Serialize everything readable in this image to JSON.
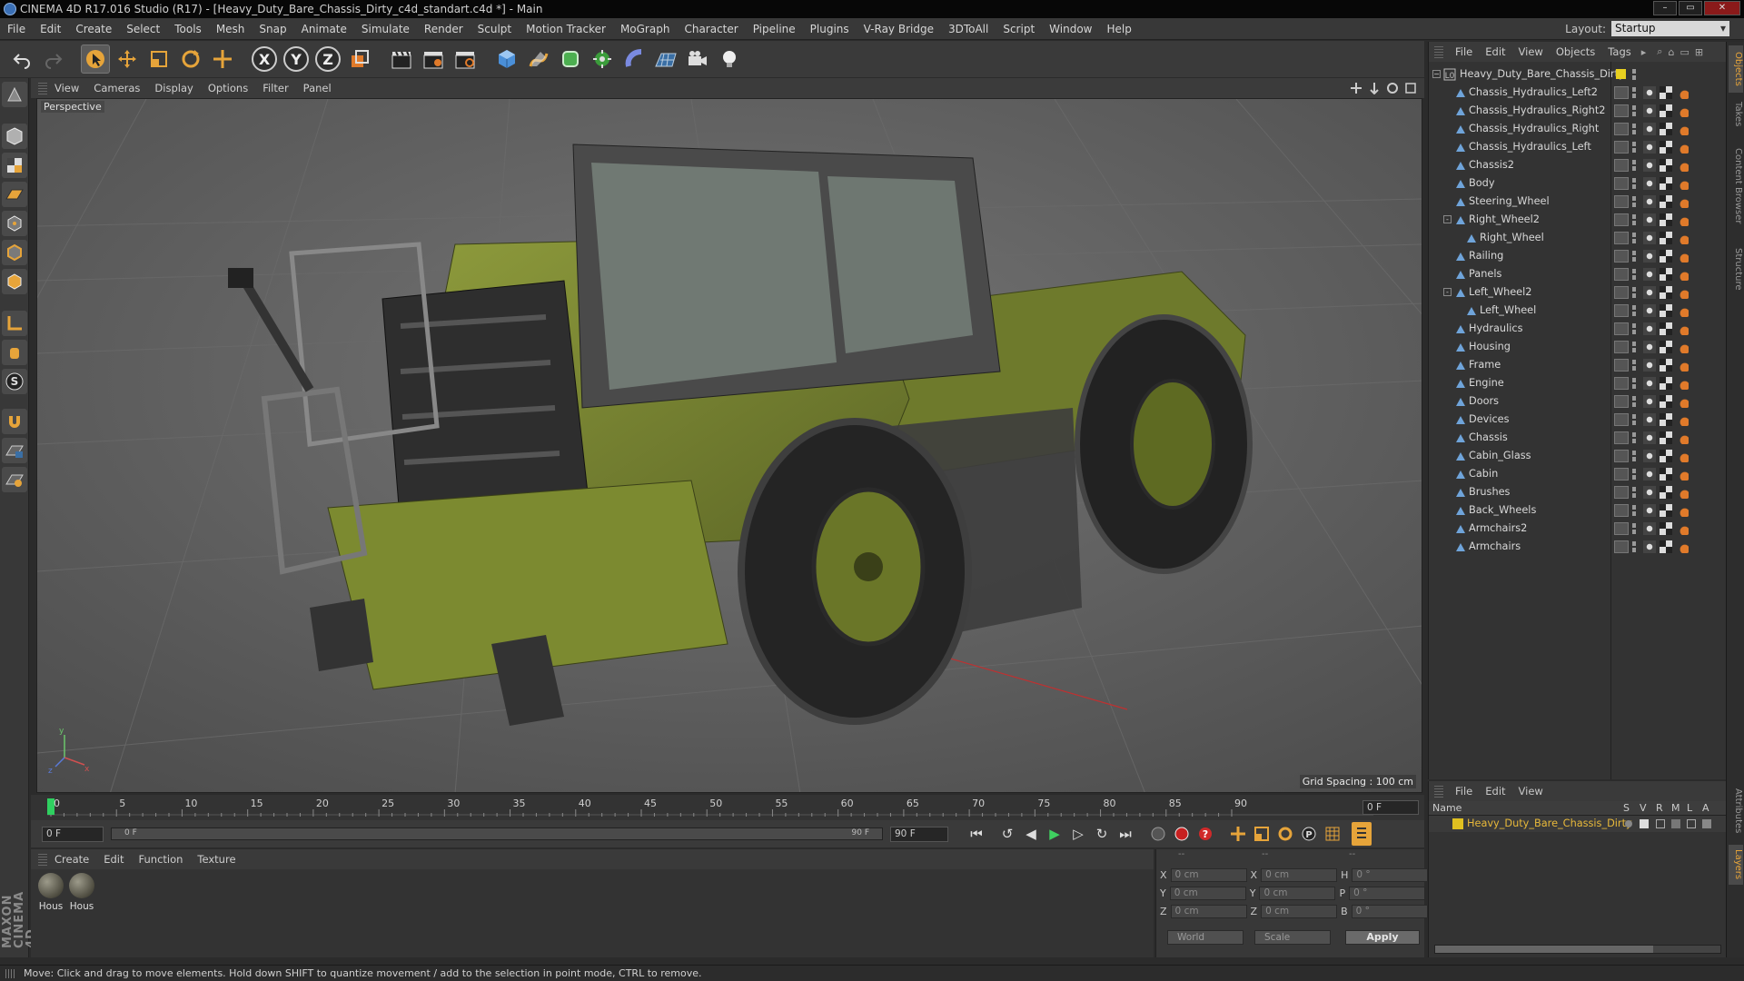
{
  "window": {
    "title": "CINEMA 4D R17.016 Studio (R17) - [Heavy_Duty_Bare_Chassis_Dirty_c4d_standart.c4d *] - Main",
    "buttons": {
      "minimize": "–",
      "maximize": "▭",
      "close": "✕"
    }
  },
  "menubar": {
    "items": [
      "File",
      "Edit",
      "Create",
      "Select",
      "Tools",
      "Mesh",
      "Snap",
      "Animate",
      "Simulate",
      "Render",
      "Sculpt",
      "Motion Tracker",
      "MoGraph",
      "Character",
      "Pipeline",
      "Plugins",
      "V-Ray Bridge",
      "3DToAll",
      "Script",
      "Window",
      "Help"
    ],
    "layout_label": "Layout:",
    "layout_value": "Startup"
  },
  "viewport": {
    "menu": [
      "View",
      "Cameras",
      "Display",
      "Options",
      "Filter",
      "Panel"
    ],
    "label": "Perspective",
    "grid_spacing": "Grid Spacing : 100 cm"
  },
  "timeline": {
    "ticks": [
      "0",
      "5",
      "10",
      "15",
      "20",
      "25",
      "30",
      "35",
      "40",
      "45",
      "50",
      "55",
      "60",
      "65",
      "70",
      "75",
      "80",
      "85",
      "90"
    ],
    "current_frame": "0 F",
    "start_field": "0 F",
    "range_start": "0 F",
    "range_end": "90 F",
    "end_field": "90 F"
  },
  "materials": {
    "menu": [
      "Create",
      "Edit",
      "Function",
      "Texture"
    ],
    "items": [
      {
        "label": "Hous"
      },
      {
        "label": "Hous"
      }
    ]
  },
  "coordinates": {
    "headers": [
      "--",
      "--",
      "--"
    ],
    "rows": [
      {
        "a": "X",
        "a_val": "0 cm",
        "b": "X",
        "b_val": "0 cm",
        "c": "H",
        "c_val": "0 °"
      },
      {
        "a": "Y",
        "a_val": "0 cm",
        "b": "Y",
        "b_val": "0 cm",
        "c": "P",
        "c_val": "0 °"
      },
      {
        "a": "Z",
        "a_val": "0 cm",
        "b": "Z",
        "b_val": "0 cm",
        "c": "B",
        "c_val": "0 °"
      }
    ],
    "space": "World",
    "mode": "Scale",
    "apply": "Apply"
  },
  "object_manager": {
    "menu": [
      "File",
      "Edit",
      "View",
      "Objects",
      "Tags"
    ],
    "root": "Heavy_Duty_Bare_Chassis_Dirty",
    "objects": [
      {
        "name": "Chassis_Hydraulics_Left2",
        "depth": 1,
        "expand": ""
      },
      {
        "name": "Chassis_Hydraulics_Right2",
        "depth": 1,
        "expand": ""
      },
      {
        "name": "Chassis_Hydraulics_Right",
        "depth": 1,
        "expand": ""
      },
      {
        "name": "Chassis_Hydraulics_Left",
        "depth": 1,
        "expand": ""
      },
      {
        "name": "Chassis2",
        "depth": 1,
        "expand": ""
      },
      {
        "name": "Body",
        "depth": 1,
        "expand": ""
      },
      {
        "name": "Steering_Wheel",
        "depth": 1,
        "expand": ""
      },
      {
        "name": "Right_Wheel2",
        "depth": 1,
        "expand": "-"
      },
      {
        "name": "Right_Wheel",
        "depth": 2,
        "expand": ""
      },
      {
        "name": "Railing",
        "depth": 1,
        "expand": ""
      },
      {
        "name": "Panels",
        "depth": 1,
        "expand": ""
      },
      {
        "name": "Left_Wheel2",
        "depth": 1,
        "expand": "-"
      },
      {
        "name": "Left_Wheel",
        "depth": 2,
        "expand": ""
      },
      {
        "name": "Hydraulics",
        "depth": 1,
        "expand": ""
      },
      {
        "name": "Housing",
        "depth": 1,
        "expand": ""
      },
      {
        "name": "Frame",
        "depth": 1,
        "expand": ""
      },
      {
        "name": "Engine",
        "depth": 1,
        "expand": ""
      },
      {
        "name": "Doors",
        "depth": 1,
        "expand": ""
      },
      {
        "name": "Devices",
        "depth": 1,
        "expand": ""
      },
      {
        "name": "Chassis",
        "depth": 1,
        "expand": ""
      },
      {
        "name": "Cabin_Glass",
        "depth": 1,
        "expand": ""
      },
      {
        "name": "Cabin",
        "depth": 1,
        "expand": ""
      },
      {
        "name": "Brushes",
        "depth": 1,
        "expand": ""
      },
      {
        "name": "Back_Wheels",
        "depth": 1,
        "expand": ""
      },
      {
        "name": "Armchairs2",
        "depth": 1,
        "expand": ""
      },
      {
        "name": "Armchairs",
        "depth": 1,
        "expand": ""
      }
    ]
  },
  "layer_manager": {
    "menu": [
      "File",
      "Edit",
      "View"
    ],
    "name_header": "Name",
    "columns": [
      "S",
      "V",
      "R",
      "M",
      "L",
      "A"
    ],
    "row": "Heavy_Duty_Bare_Chassis_Dirty"
  },
  "side_tabs": [
    "Objects",
    "Takes",
    "Content Browser",
    "Structure",
    "Attributes",
    "Layers"
  ],
  "status": "Move: Click and drag to move elements. Hold down SHIFT to quantize movement / add to the selection in point mode, CTRL to remove.",
  "colors": {
    "accent": "#e6a43a",
    "layer_text": "#e8b93a",
    "layer_swatch": "#e0c020",
    "root_swatch": "#e8d020"
  }
}
